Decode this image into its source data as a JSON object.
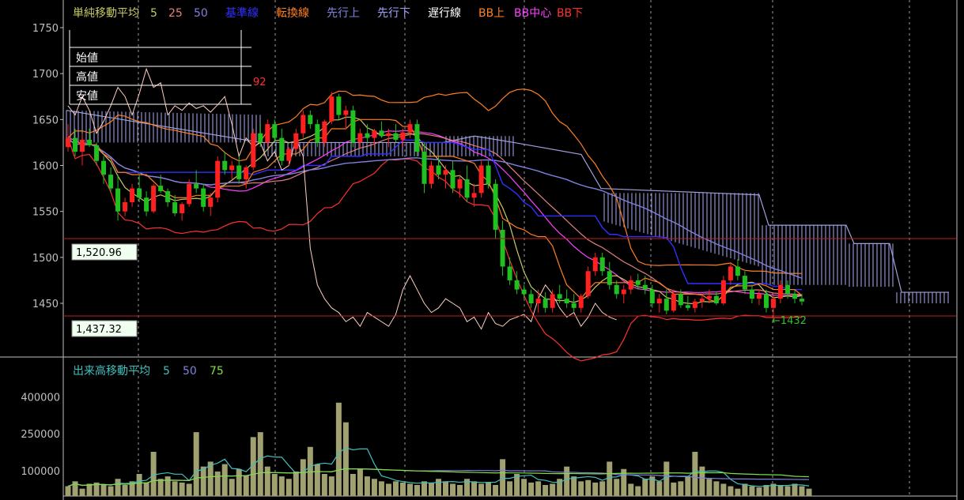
{
  "price_panel": {
    "legend": [
      {
        "label": "単純移動平均",
        "color": "#c8c864"
      },
      {
        "label": "5",
        "color": "#c8c864"
      },
      {
        "label": "25",
        "color": "#e08080"
      },
      {
        "label": "50",
        "color": "#8080e0"
      },
      {
        "label": "基準線",
        "color": "#3030ff"
      },
      {
        "label": "転換線",
        "color": "#ff8020"
      },
      {
        "label": "先行上",
        "color": "#8080e0"
      },
      {
        "label": "先行下",
        "color": "#a0a0ff"
      },
      {
        "label": "遅行線",
        "color": "#ffffff"
      },
      {
        "label": "BB上",
        "color": "#ff8020"
      },
      {
        "label": "BB中心",
        "color": "#ff40ff"
      },
      {
        "label": "BB下",
        "color": "#ff3030"
      }
    ],
    "y_ticks": [
      "1750",
      "1700",
      "1650",
      "1600",
      "1550",
      "1500",
      "1450"
    ],
    "info_rows": [
      "始値",
      "高値",
      "安値"
    ],
    "peak_partial_label": "92",
    "hline_labels": [
      "1,520.96",
      "1,437.32"
    ],
    "min_label": "←1432"
  },
  "volume_panel": {
    "legend": [
      {
        "label": "出来高移動平均",
        "color": "#40c0c0"
      },
      {
        "label": "5",
        "color": "#40c0c0"
      },
      {
        "label": "50",
        "color": "#8080e0"
      },
      {
        "label": "75",
        "color": "#80e040"
      }
    ],
    "y_ticks": [
      "400000",
      "250000",
      "100000"
    ]
  },
  "colors": {
    "background": "#000000",
    "up_candle": "#ff2020",
    "down_candle": "#20c020",
    "volume_bar": "#a0a070",
    "hline": "#c02020",
    "cloud": "#9090d0",
    "grid": "#c0c0c0"
  },
  "chart_data": [
    {
      "type": "candlestick",
      "title": "",
      "ylim": [
        1400,
        1760
      ],
      "hlines": [
        1520.96,
        1437.32
      ],
      "price_markers": {
        "recent_low": 1432
      },
      "candles": [
        [
          1620,
          1645,
          1615,
          1630
        ],
        [
          1630,
          1640,
          1610,
          1615
        ],
        [
          1615,
          1635,
          1600,
          1628
        ],
        [
          1628,
          1640,
          1620,
          1622
        ],
        [
          1622,
          1625,
          1600,
          1605
        ],
        [
          1605,
          1610,
          1580,
          1590
        ],
        [
          1590,
          1598,
          1570,
          1575
        ],
        [
          1575,
          1590,
          1540,
          1550
        ],
        [
          1550,
          1565,
          1545,
          1560
        ],
        [
          1560,
          1580,
          1555,
          1575
        ],
        [
          1575,
          1590,
          1560,
          1565
        ],
        [
          1565,
          1572,
          1545,
          1550
        ],
        [
          1550,
          1580,
          1548,
          1578
        ],
        [
          1578,
          1590,
          1570,
          1572
        ],
        [
          1572,
          1575,
          1555,
          1560
        ],
        [
          1560,
          1568,
          1545,
          1548
        ],
        [
          1548,
          1560,
          1540,
          1558
        ],
        [
          1558,
          1585,
          1555,
          1580
        ],
        [
          1580,
          1595,
          1570,
          1575
        ],
        [
          1575,
          1580,
          1550,
          1555
        ],
        [
          1555,
          1570,
          1545,
          1565
        ],
        [
          1565,
          1610,
          1560,
          1605
        ],
        [
          1605,
          1615,
          1590,
          1595
        ],
        [
          1595,
          1605,
          1585,
          1600
        ],
        [
          1600,
          1610,
          1580,
          1585
        ],
        [
          1585,
          1600,
          1575,
          1598
        ],
        [
          1598,
          1640,
          1595,
          1635
        ],
        [
          1635,
          1645,
          1620,
          1625
        ],
        [
          1625,
          1650,
          1620,
          1645
        ],
        [
          1645,
          1650,
          1625,
          1630
        ],
        [
          1630,
          1640,
          1600,
          1605
        ],
        [
          1605,
          1620,
          1600,
          1618
        ],
        [
          1618,
          1640,
          1615,
          1635
        ],
        [
          1635,
          1660,
          1630,
          1655
        ],
        [
          1655,
          1660,
          1640,
          1645
        ],
        [
          1645,
          1650,
          1620,
          1625
        ],
        [
          1625,
          1650,
          1620,
          1648
        ],
        [
          1648,
          1680,
          1645,
          1675
        ],
        [
          1675,
          1678,
          1650,
          1655
        ],
        [
          1655,
          1665,
          1640,
          1660
        ],
        [
          1660,
          1665,
          1620,
          1625
        ],
        [
          1625,
          1640,
          1620,
          1635
        ],
        [
          1635,
          1645,
          1625,
          1630
        ],
        [
          1630,
          1640,
          1620,
          1638
        ],
        [
          1638,
          1648,
          1630,
          1632
        ],
        [
          1632,
          1640,
          1620,
          1635
        ],
        [
          1635,
          1645,
          1625,
          1628
        ],
        [
          1628,
          1640,
          1620,
          1636
        ],
        [
          1636,
          1650,
          1630,
          1645
        ],
        [
          1645,
          1650,
          1610,
          1615
        ],
        [
          1615,
          1625,
          1570,
          1580
        ],
        [
          1580,
          1605,
          1575,
          1600
        ],
        [
          1600,
          1610,
          1585,
          1590
        ],
        [
          1590,
          1600,
          1575,
          1595
        ],
        [
          1595,
          1605,
          1570,
          1575
        ],
        [
          1575,
          1590,
          1565,
          1585
        ],
        [
          1585,
          1600,
          1560,
          1565
        ],
        [
          1565,
          1580,
          1555,
          1570
        ],
        [
          1570,
          1605,
          1565,
          1600
        ],
        [
          1600,
          1605,
          1575,
          1580
        ],
        [
          1580,
          1585,
          1520,
          1530
        ],
        [
          1530,
          1540,
          1480,
          1490
        ],
        [
          1490,
          1500,
          1470,
          1475
        ],
        [
          1475,
          1485,
          1460,
          1465
        ],
        [
          1465,
          1470,
          1455,
          1460
        ],
        [
          1460,
          1465,
          1445,
          1450
        ],
        [
          1450,
          1465,
          1440,
          1455
        ],
        [
          1455,
          1462,
          1440,
          1445
        ],
        [
          1445,
          1465,
          1440,
          1460
        ],
        [
          1460,
          1470,
          1450,
          1455
        ],
        [
          1455,
          1465,
          1445,
          1450
        ],
        [
          1450,
          1460,
          1440,
          1445
        ],
        [
          1445,
          1460,
          1440,
          1458
        ],
        [
          1458,
          1490,
          1455,
          1485
        ],
        [
          1485,
          1505,
          1480,
          1500
        ],
        [
          1500,
          1505,
          1480,
          1485
        ],
        [
          1485,
          1495,
          1465,
          1470
        ],
        [
          1470,
          1475,
          1455,
          1460
        ],
        [
          1460,
          1470,
          1450,
          1465
        ],
        [
          1465,
          1480,
          1460,
          1475
        ],
        [
          1475,
          1482,
          1465,
          1470
        ],
        [
          1470,
          1480,
          1460,
          1465
        ],
        [
          1465,
          1470,
          1445,
          1450
        ],
        [
          1450,
          1460,
          1440,
          1455
        ],
        [
          1455,
          1465,
          1438,
          1442
        ],
        [
          1442,
          1465,
          1440,
          1460
        ],
        [
          1460,
          1465,
          1445,
          1448
        ],
        [
          1448,
          1458,
          1442,
          1445
        ],
        [
          1445,
          1455,
          1440,
          1452
        ],
        [
          1452,
          1460,
          1445,
          1455
        ],
        [
          1455,
          1465,
          1450,
          1458
        ],
        [
          1458,
          1462,
          1448,
          1450
        ],
        [
          1450,
          1480,
          1448,
          1475
        ],
        [
          1475,
          1495,
          1470,
          1490
        ],
        [
          1490,
          1498,
          1475,
          1480
        ],
        [
          1480,
          1485,
          1460,
          1465
        ],
        [
          1465,
          1470,
          1450,
          1455
        ],
        [
          1455,
          1465,
          1448,
          1460
        ],
        [
          1460,
          1465,
          1440,
          1445
        ],
        [
          1445,
          1460,
          1432,
          1455
        ],
        [
          1455,
          1475,
          1450,
          1470
        ],
        [
          1470,
          1475,
          1455,
          1460
        ],
        [
          1460,
          1465,
          1450,
          1455
        ],
        [
          1455,
          1460,
          1448,
          1452
        ]
      ]
    },
    {
      "type": "bar",
      "title": "",
      "ylim": [
        0,
        450000
      ],
      "values": [
        40000,
        60000,
        30000,
        50000,
        55000,
        45000,
        40000,
        70000,
        45000,
        60000,
        90000,
        55000,
        180000,
        70000,
        80000,
        60000,
        55000,
        50000,
        260000,
        120000,
        140000,
        100000,
        130000,
        70000,
        110000,
        85000,
        240000,
        260000,
        120000,
        90000,
        80000,
        70000,
        100000,
        150000,
        200000,
        130000,
        90000,
        80000,
        380000,
        300000,
        90000,
        110000,
        80000,
        70000,
        60000,
        50000,
        60000,
        55000,
        50000,
        45000,
        60000,
        55000,
        70000,
        60000,
        50000,
        45000,
        70000,
        60000,
        50000,
        55000,
        45000,
        150000,
        60000,
        90000,
        70000,
        55000,
        60000,
        45000,
        50000,
        70000,
        120000,
        80000,
        60000,
        65000,
        55000,
        60000,
        140000,
        70000,
        110000,
        50000,
        40000,
        70000,
        80000,
        60000,
        140000,
        55000,
        60000,
        80000,
        180000,
        120000,
        70000,
        60000,
        50000,
        40000,
        30000,
        50000,
        40000,
        35000,
        45000,
        50000,
        45000,
        40000,
        50000,
        40000,
        30000
      ]
    }
  ]
}
